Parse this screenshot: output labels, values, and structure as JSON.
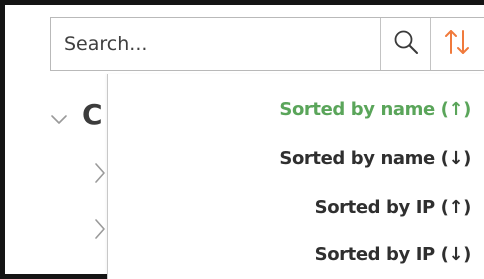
{
  "search": {
    "placeholder": "Search..."
  },
  "icons": {
    "search": "search-icon",
    "sort": "sort-arrows-icon",
    "tree_expand": "chevron-down-icon",
    "tree_child": "chevron-right-icon"
  },
  "tree": {
    "node_initial": "C"
  },
  "sort_menu": {
    "items": [
      {
        "label": "Sorted by name (↑)",
        "active": true
      },
      {
        "label": "Sorted by name (↓)",
        "active": false
      },
      {
        "label": "Sorted by IP (↑)",
        "active": false
      },
      {
        "label": "Sorted by IP (↓)",
        "active": false
      }
    ]
  },
  "colors": {
    "active_item": "#5aa55a",
    "sort_icon": "#f07a3c",
    "text": "#2f2f2f",
    "frame": "#141414"
  }
}
